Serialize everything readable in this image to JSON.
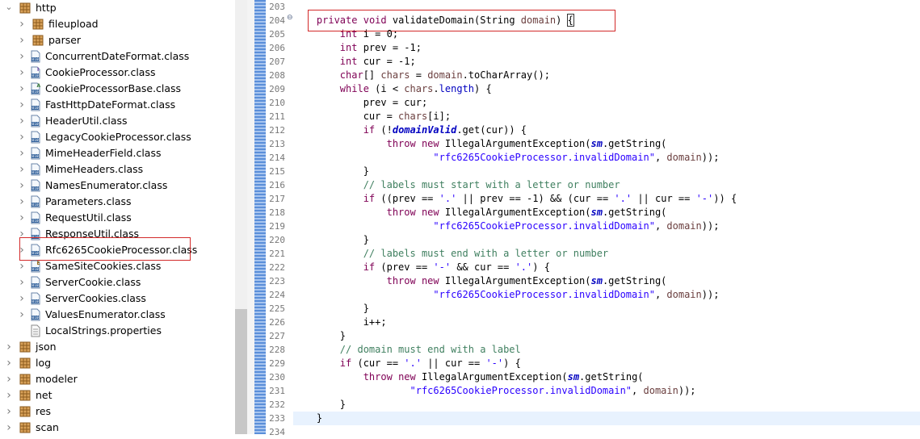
{
  "tree": {
    "nodes": [
      {
        "label": "http",
        "type": "package",
        "depth": 0,
        "expanded": true
      },
      {
        "label": "fileupload",
        "type": "package",
        "depth": 1,
        "expanded": false
      },
      {
        "label": "parser",
        "type": "package",
        "depth": 1,
        "expanded": false
      },
      {
        "label": "ConcurrentDateFormat.class",
        "type": "class",
        "depth": 1
      },
      {
        "label": "CookieProcessor.class",
        "type": "interface",
        "depth": 1
      },
      {
        "label": "CookieProcessorBase.class",
        "type": "abstract",
        "depth": 1
      },
      {
        "label": "FastHttpDateFormat.class",
        "type": "class",
        "depth": 1
      },
      {
        "label": "HeaderUtil.class",
        "type": "class",
        "depth": 1
      },
      {
        "label": "LegacyCookieProcessor.class",
        "type": "class",
        "depth": 1
      },
      {
        "label": "MimeHeaderField.class",
        "type": "class",
        "depth": 1
      },
      {
        "label": "MimeHeaders.class",
        "type": "class",
        "depth": 1
      },
      {
        "label": "NamesEnumerator.class",
        "type": "class",
        "depth": 1
      },
      {
        "label": "Parameters.class",
        "type": "class",
        "depth": 1
      },
      {
        "label": "RequestUtil.class",
        "type": "class",
        "depth": 1
      },
      {
        "label": "ResponseUtil.class",
        "type": "class",
        "depth": 1
      },
      {
        "label": "Rfc6265CookieProcessor.class",
        "type": "class",
        "depth": 1,
        "highlighted": true
      },
      {
        "label": "SameSiteCookies.class",
        "type": "enum",
        "depth": 1
      },
      {
        "label": "ServerCookie.class",
        "type": "class",
        "depth": 1
      },
      {
        "label": "ServerCookies.class",
        "type": "class",
        "depth": 1
      },
      {
        "label": "ValuesEnumerator.class",
        "type": "class",
        "depth": 1
      },
      {
        "label": "LocalStrings.properties",
        "type": "file",
        "depth": 1
      },
      {
        "label": "json",
        "type": "package",
        "depth": 0,
        "expanded": false
      },
      {
        "label": "log",
        "type": "package",
        "depth": 0,
        "expanded": false
      },
      {
        "label": "modeler",
        "type": "package",
        "depth": 0,
        "expanded": false
      },
      {
        "label": "net",
        "type": "package",
        "depth": 0,
        "expanded": false
      },
      {
        "label": "res",
        "type": "package",
        "depth": 0,
        "expanded": false
      },
      {
        "label": "scan",
        "type": "package",
        "depth": 0,
        "expanded": false
      }
    ]
  },
  "editor": {
    "fold_marker": "⊖",
    "lines": [
      {
        "n": "203",
        "tokens": []
      },
      {
        "n": "204",
        "highlighted": true,
        "tokens": [
          [
            "plain",
            "    "
          ],
          [
            "kw",
            "private"
          ],
          [
            "plain",
            " "
          ],
          [
            "kw",
            "void"
          ],
          [
            "plain",
            " validateDomain(String "
          ],
          [
            "param",
            "domain"
          ],
          [
            "plain",
            ") "
          ],
          [
            "brace",
            "{"
          ]
        ]
      },
      {
        "n": "205",
        "tokens": [
          [
            "plain",
            "        "
          ],
          [
            "kw",
            "int"
          ],
          [
            "plain",
            " i = 0;"
          ]
        ]
      },
      {
        "n": "206",
        "tokens": [
          [
            "plain",
            "        "
          ],
          [
            "kw",
            "int"
          ],
          [
            "plain",
            " prev = -1;"
          ]
        ]
      },
      {
        "n": "207",
        "tokens": [
          [
            "plain",
            "        "
          ],
          [
            "kw",
            "int"
          ],
          [
            "plain",
            " cur = -1;"
          ]
        ]
      },
      {
        "n": "208",
        "tokens": [
          [
            "plain",
            "        "
          ],
          [
            "kw",
            "char"
          ],
          [
            "plain",
            "[] "
          ],
          [
            "param",
            "chars"
          ],
          [
            "plain",
            " = "
          ],
          [
            "param",
            "domain"
          ],
          [
            "plain",
            ".toCharArray();"
          ]
        ]
      },
      {
        "n": "209",
        "tokens": [
          [
            "plain",
            "        "
          ],
          [
            "kw",
            "while"
          ],
          [
            "plain",
            " (i < "
          ],
          [
            "param",
            "chars"
          ],
          [
            "plain",
            "."
          ],
          [
            "field",
            "length"
          ],
          [
            "plain",
            ") {"
          ]
        ]
      },
      {
        "n": "210",
        "tokens": [
          [
            "plain",
            "            prev = cur;"
          ]
        ]
      },
      {
        "n": "211",
        "tokens": [
          [
            "plain",
            "            cur = "
          ],
          [
            "param",
            "chars"
          ],
          [
            "plain",
            "[i];"
          ]
        ]
      },
      {
        "n": "212",
        "tokens": [
          [
            "plain",
            "            "
          ],
          [
            "kw",
            "if"
          ],
          [
            "plain",
            " (!"
          ],
          [
            "sfield",
            "domainValid"
          ],
          [
            "plain",
            ".get(cur)) {"
          ]
        ]
      },
      {
        "n": "213",
        "tokens": [
          [
            "plain",
            "                "
          ],
          [
            "kw",
            "throw"
          ],
          [
            "plain",
            " "
          ],
          [
            "kw",
            "new"
          ],
          [
            "plain",
            " IllegalArgumentException("
          ],
          [
            "sfield",
            "sm"
          ],
          [
            "plain",
            ".getString("
          ]
        ]
      },
      {
        "n": "214",
        "tokens": [
          [
            "plain",
            "                        "
          ],
          [
            "str",
            "\"rfc6265CookieProcessor.invalidDomain\""
          ],
          [
            "plain",
            ", "
          ],
          [
            "param",
            "domain"
          ],
          [
            "plain",
            "));"
          ]
        ]
      },
      {
        "n": "215",
        "tokens": [
          [
            "plain",
            "            }"
          ]
        ]
      },
      {
        "n": "216",
        "tokens": [
          [
            "plain",
            "            "
          ],
          [
            "com",
            "// labels must start with a letter or number"
          ]
        ]
      },
      {
        "n": "217",
        "tokens": [
          [
            "plain",
            "            "
          ],
          [
            "kw",
            "if"
          ],
          [
            "plain",
            " ((prev == "
          ],
          [
            "str",
            "'.'"
          ],
          [
            "plain",
            " || prev == -1) && (cur == "
          ],
          [
            "str",
            "'.'"
          ],
          [
            "plain",
            " || cur == "
          ],
          [
            "str",
            "'-'"
          ],
          [
            "plain",
            ")) {"
          ]
        ]
      },
      {
        "n": "218",
        "tokens": [
          [
            "plain",
            "                "
          ],
          [
            "kw",
            "throw"
          ],
          [
            "plain",
            " "
          ],
          [
            "kw",
            "new"
          ],
          [
            "plain",
            " IllegalArgumentException("
          ],
          [
            "sfield",
            "sm"
          ],
          [
            "plain",
            ".getString("
          ]
        ]
      },
      {
        "n": "219",
        "tokens": [
          [
            "plain",
            "                        "
          ],
          [
            "str",
            "\"rfc6265CookieProcessor.invalidDomain\""
          ],
          [
            "plain",
            ", "
          ],
          [
            "param",
            "domain"
          ],
          [
            "plain",
            "));"
          ]
        ]
      },
      {
        "n": "220",
        "tokens": [
          [
            "plain",
            "            }"
          ]
        ]
      },
      {
        "n": "221",
        "tokens": [
          [
            "plain",
            "            "
          ],
          [
            "com",
            "// labels must end with a letter or number"
          ]
        ]
      },
      {
        "n": "222",
        "tokens": [
          [
            "plain",
            "            "
          ],
          [
            "kw",
            "if"
          ],
          [
            "plain",
            " (prev == "
          ],
          [
            "str",
            "'-'"
          ],
          [
            "plain",
            " && cur == "
          ],
          [
            "str",
            "'.'"
          ],
          [
            "plain",
            ") {"
          ]
        ]
      },
      {
        "n": "223",
        "tokens": [
          [
            "plain",
            "                "
          ],
          [
            "kw",
            "throw"
          ],
          [
            "plain",
            " "
          ],
          [
            "kw",
            "new"
          ],
          [
            "plain",
            " IllegalArgumentException("
          ],
          [
            "sfield",
            "sm"
          ],
          [
            "plain",
            ".getString("
          ]
        ]
      },
      {
        "n": "224",
        "tokens": [
          [
            "plain",
            "                        "
          ],
          [
            "str",
            "\"rfc6265CookieProcessor.invalidDomain\""
          ],
          [
            "plain",
            ", "
          ],
          [
            "param",
            "domain"
          ],
          [
            "plain",
            "));"
          ]
        ]
      },
      {
        "n": "225",
        "tokens": [
          [
            "plain",
            "            }"
          ]
        ]
      },
      {
        "n": "226",
        "tokens": [
          [
            "plain",
            "            i++;"
          ]
        ]
      },
      {
        "n": "227",
        "tokens": [
          [
            "plain",
            "        }"
          ]
        ]
      },
      {
        "n": "228",
        "tokens": [
          [
            "plain",
            "        "
          ],
          [
            "com",
            "// domain must end with a label"
          ]
        ]
      },
      {
        "n": "229",
        "tokens": [
          [
            "plain",
            "        "
          ],
          [
            "kw",
            "if"
          ],
          [
            "plain",
            " (cur == "
          ],
          [
            "str",
            "'.'"
          ],
          [
            "plain",
            " || cur == "
          ],
          [
            "str",
            "'-'"
          ],
          [
            "plain",
            ") {"
          ]
        ]
      },
      {
        "n": "230",
        "tokens": [
          [
            "plain",
            "            "
          ],
          [
            "kw",
            "throw"
          ],
          [
            "plain",
            " "
          ],
          [
            "kw",
            "new"
          ],
          [
            "plain",
            " IllegalArgumentException("
          ],
          [
            "sfield",
            "sm"
          ],
          [
            "plain",
            ".getString("
          ]
        ]
      },
      {
        "n": "231",
        "tokens": [
          [
            "plain",
            "                    "
          ],
          [
            "str",
            "\"rfc6265CookieProcessor.invalidDomain\""
          ],
          [
            "plain",
            ", "
          ],
          [
            "param",
            "domain"
          ],
          [
            "plain",
            "));"
          ]
        ]
      },
      {
        "n": "232",
        "tokens": [
          [
            "plain",
            "        }"
          ]
        ]
      },
      {
        "n": "233",
        "current": true,
        "tokens": [
          [
            "plain",
            "    }"
          ]
        ]
      },
      {
        "n": "234",
        "tokens": []
      }
    ]
  }
}
